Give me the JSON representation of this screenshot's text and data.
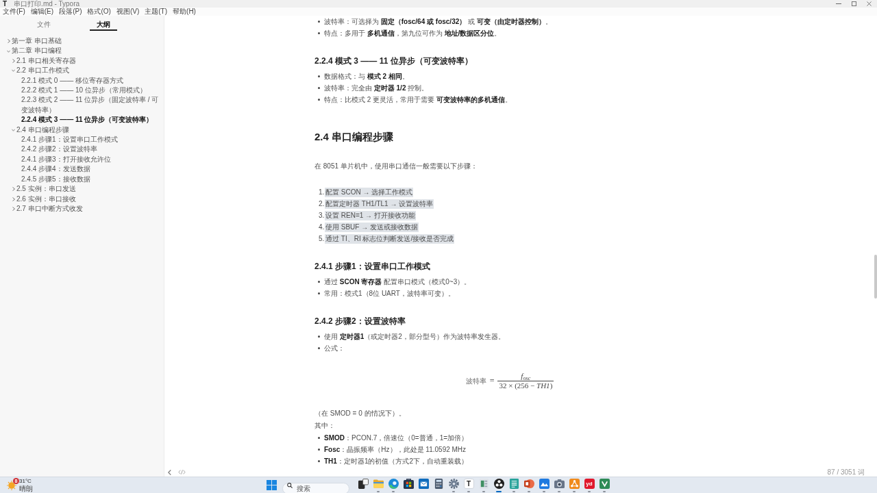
{
  "window": {
    "icon_letter": "T",
    "title": "串口打印.md - Typora"
  },
  "menu": [
    "文件(F)",
    "编辑(E)",
    "段落(P)",
    "格式(O)",
    "视图(V)",
    "主题(T)",
    "帮助(H)"
  ],
  "sidebar": {
    "tabs": [
      {
        "label": "文件",
        "selected": false
      },
      {
        "label": "大纲",
        "selected": true
      }
    ],
    "outline": [
      {
        "label": "第一章 串口基础",
        "expanded": false,
        "selected": false
      },
      {
        "label": "第二章 串口编程",
        "expanded": true,
        "selected": false,
        "children": [
          {
            "label": "2.1 串口相关寄存器",
            "expanded": false,
            "selected": false
          },
          {
            "label": "2.2 串口工作模式",
            "expanded": true,
            "selected": false,
            "children": [
              {
                "label": "2.2.1 模式 0 —— 移位寄存器方式",
                "selected": false
              },
              {
                "label": "2.2.2 模式 1 —— 10 位异步（常用模式）",
                "selected": false
              },
              {
                "label": "2.2.3 模式 2 —— 11 位异步（固定波特率 / 可变波特率）",
                "selected": false
              },
              {
                "label": "2.2.4 模式 3 —— 11 位异步（可变波特率）",
                "selected": true
              }
            ]
          },
          {
            "label": "2.4 串口编程步骤",
            "expanded": true,
            "selected": false,
            "children": [
              {
                "label": "2.4.1 步骤1：设置串口工作模式",
                "selected": false
              },
              {
                "label": "2.4.2 步骤2：设置波特率",
                "selected": false
              },
              {
                "label": "2.4.1 步骤3：打开接收允许位",
                "selected": false
              },
              {
                "label": "2.4.4 步骤4：发送数据",
                "selected": false
              },
              {
                "label": "2.4.5 步骤5：接收数据",
                "selected": false
              }
            ]
          },
          {
            "label": "2.5 实例：串口发送",
            "expanded": false,
            "selected": false
          },
          {
            "label": "2.6 实例：串口接收",
            "expanded": false,
            "selected": false
          },
          {
            "label": "2.7 串口中断方式收发",
            "expanded": false,
            "selected": false
          }
        ]
      }
    ]
  },
  "document": {
    "blocks": [
      {
        "kind": "bullets",
        "items": [
          "波特率：可选择为 **固定（fosc/64 或 fosc/32）** 或 **可变（由定时器控制）**。",
          "特点：多用于 **多机通信**，第九位可作为 **地址/数据区分位**。"
        ]
      },
      {
        "kind": "h3",
        "text": "2.2.4 模式 3 —— 11 位异步（可变波特率）"
      },
      {
        "kind": "bullets",
        "items": [
          "数据格式：与 **模式 2 相同**。",
          "波特率：完全由 **定时器 1/2** 控制。",
          "特点：比模式 2 更灵活，常用于需要 **可变波特率的多机通信**。"
        ]
      },
      {
        "kind": "h2",
        "text": "2.4 串口编程步骤"
      },
      {
        "kind": "paragraph",
        "text": "在 8051 单片机中，使用串口通信一般需要以下步骤："
      },
      {
        "kind": "ordered",
        "items": [
          {
            "number": "1.",
            "text": "配置 SCON → 选择工作模式",
            "selected": true
          },
          {
            "number": "2.",
            "text": "配置定时器 TH1/TL1 → 设置波特率",
            "selected": true
          },
          {
            "number": "3.",
            "text": "设置 REN=1 → 打开接收功能",
            "selected": true
          },
          {
            "number": "4.",
            "text": "使用 SBUF → 发送或接收数据",
            "selected": true
          },
          {
            "number": "5.",
            "text": "通过 TI、RI 标志位判断发送/接收是否完成",
            "selected": true
          }
        ]
      },
      {
        "kind": "h3",
        "text": "2.4.1 步骤1：设置串口工作模式"
      },
      {
        "kind": "bullets",
        "items": [
          "通过 **SCON 寄存器** 配置串口模式（模式0~3）。",
          "常用：模式1（8位 UART，波特率可变）。"
        ]
      },
      {
        "kind": "h3",
        "text": "2.4.2 步骤2：设置波特率"
      },
      {
        "kind": "bullets",
        "items": [
          "使用 **定时器1**（或定时器2，部分型号）作为波特率发生器。",
          "公式："
        ]
      },
      {
        "kind": "formula",
        "lhs": "波特率",
        "operator": "=",
        "numerator": "f$_{osc}$",
        "denominator": "32 × (256 − *TH1*)"
      },
      {
        "kind": "paragraph",
        "text": "（在 SMOD = 0 的情况下）。"
      },
      {
        "kind": "paragraph",
        "text": "其中："
      },
      {
        "kind": "bullets",
        "items": [
          "**SMOD**：PCON.7，倍速位（0=普通，1=加倍）",
          "**Fosc**：晶振频率（Hz），此处是 11.0592 MHz",
          "**TH1**：定时器1的初值（方式2下，自动重装载）"
        ]
      }
    ]
  },
  "footer": {
    "word_count": "87 / 3051 词"
  },
  "taskbar": {
    "weather": {
      "badge": "8",
      "temperature": "31°C",
      "condition": "晴朗"
    },
    "search": {
      "placeholder": "搜索"
    },
    "apps": [
      {
        "kind": "taskview",
        "running": false,
        "active": false
      },
      {
        "kind": "folder",
        "running": true,
        "active": false
      },
      {
        "kind": "browser",
        "running": true,
        "active": false
      },
      {
        "kind": "store",
        "running": false,
        "active": false
      },
      {
        "kind": "mail",
        "running": false,
        "active": false
      },
      {
        "kind": "calculator",
        "running": false,
        "active": false
      },
      {
        "kind": "settings",
        "running": true,
        "active": false
      },
      {
        "kind": "editor",
        "label": "T",
        "running": true,
        "active": false
      },
      {
        "kind": "document",
        "running": true,
        "active": false
      },
      {
        "kind": "recorder",
        "running": true,
        "active": true
      },
      {
        "kind": "notepad",
        "running": true,
        "active": false
      },
      {
        "kind": "slides",
        "running": true,
        "active": false
      },
      {
        "kind": "photos",
        "running": true,
        "active": false
      },
      {
        "kind": "camera",
        "running": true,
        "active": false
      },
      {
        "kind": "network",
        "running": true,
        "active": false
      },
      {
        "kind": "dictionary",
        "label": "yd",
        "running": true,
        "active": false
      },
      {
        "kind": "sheet",
        "running": true,
        "active": false
      }
    ]
  }
}
